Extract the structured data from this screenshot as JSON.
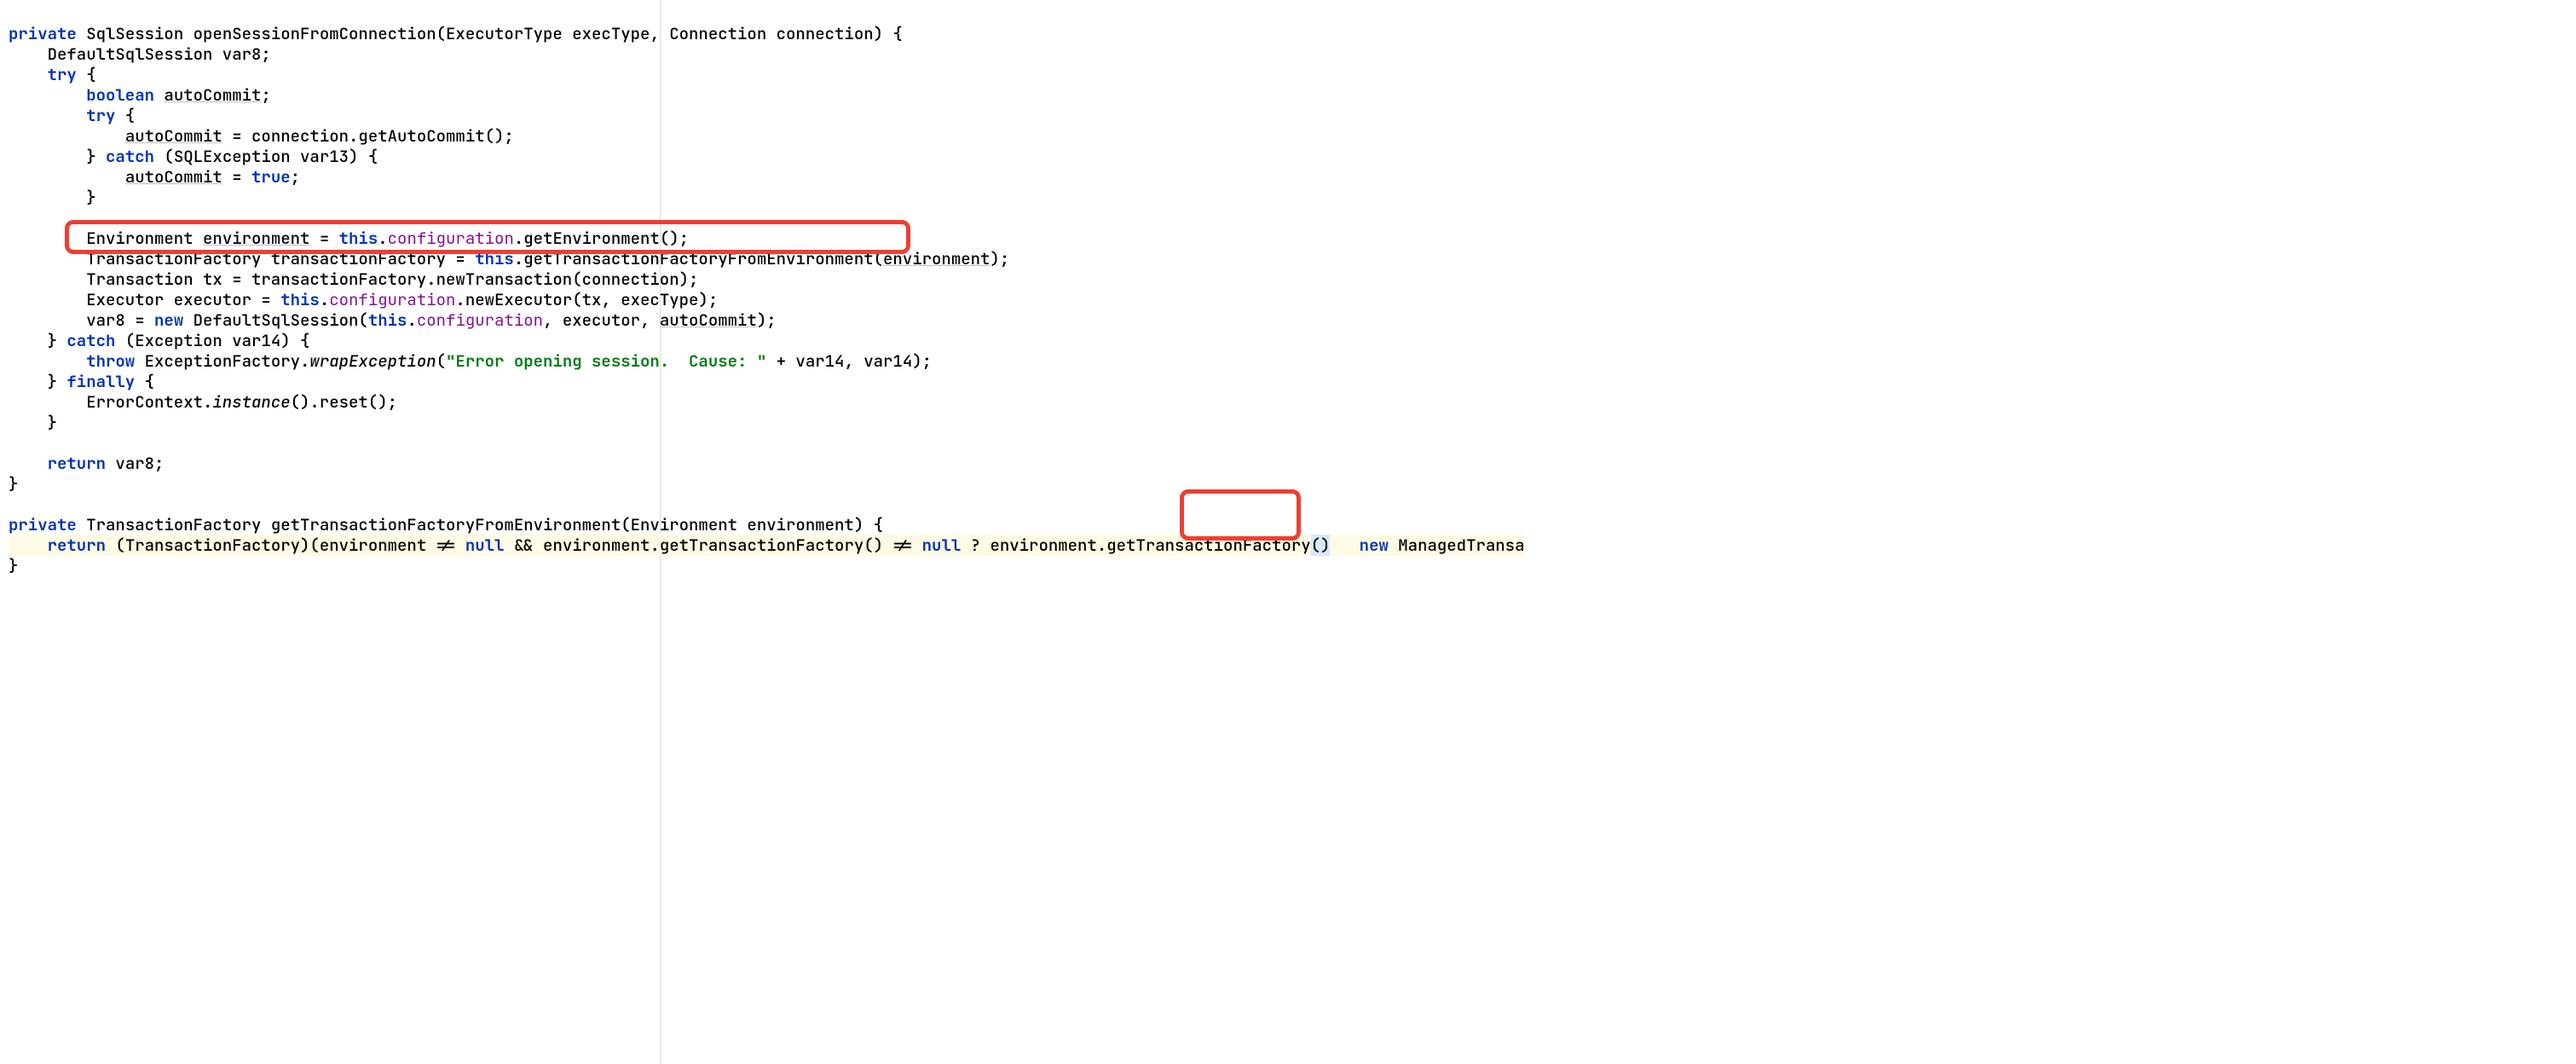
{
  "code": {
    "l01_a": "private",
    "l01_b": " SqlSession openSessionFromConnection(ExecutorType execType, Connection connection) {",
    "l02": "    DefaultSqlSession var8;",
    "l03_a": "    ",
    "l03_b": "try",
    "l03_c": " {",
    "l04_a": "        ",
    "l04_b": "boolean",
    "l04_c": " ",
    "l04_d": "autoCommit",
    "l04_e": ";",
    "l05_a": "        ",
    "l05_b": "try",
    "l05_c": " {",
    "l06_a": "            ",
    "l06_b": "autoCommit",
    "l06_c": " = connection.getAutoCommit();",
    "l07_a": "        } ",
    "l07_b": "catch",
    "l07_c": " (SQLException var13) {",
    "l08_a": "            ",
    "l08_b": "autoCommit",
    "l08_c": " = ",
    "l08_d": "true",
    "l08_e": ";",
    "l09": "        }",
    "l10": "",
    "l11_a": "        Environment ",
    "l11_b": "environment",
    "l11_c": " = ",
    "l11_d": "this",
    "l11_e": ".",
    "l11_f": "configuration",
    "l11_g": ".getEnvironment();",
    "l12_a": "        TransactionFactory transactionFactory = ",
    "l12_b": "this",
    "l12_c": ".getTransactionFactoryFromEnvironment(",
    "l12_d": "environment",
    "l12_e": ");",
    "l13": "        Transaction tx = transactionFactory.newTransaction(connection);",
    "l14_a": "        Executor executor = ",
    "l14_b": "this",
    "l14_c": ".",
    "l14_d": "configuration",
    "l14_e": ".newExecutor(tx, execType);",
    "l15_a": "        var8 = ",
    "l15_b": "new",
    "l15_c": " DefaultSqlSession(",
    "l15_d": "this",
    "l15_e": ".",
    "l15_f": "configuration",
    "l15_g": ", executor, ",
    "l15_h": "autoCommit",
    "l15_i": ");",
    "l16_a": "    } ",
    "l16_b": "catch",
    "l16_c": " (Exception var14) {",
    "l17_a": "        ",
    "l17_b": "throw",
    "l17_c": " ExceptionFactory.",
    "l17_d": "wrapException",
    "l17_e": "(",
    "l17_f": "\"Error opening session.  Cause: \"",
    "l17_g": " + var14, var14);",
    "l18_a": "    } ",
    "l18_b": "finally",
    "l18_c": " {",
    "l19_a": "        ErrorContext.",
    "l19_b": "instance",
    "l19_c": "().reset();",
    "l20": "    }",
    "l21": "",
    "l22_a": "    ",
    "l22_b": "return",
    "l22_c": " var8;",
    "l23": "}",
    "l24": "",
    "l25_a": "private",
    "l25_b": " TransactionFactory getTransactionFactoryFromEnvironment(Environment environment) {",
    "l26_a": "    ",
    "l26_b": "return",
    "l26_c": " (TransactionFactory)(environment != ",
    "l26_d": "null",
    "l26_e": " && environment.getTransactionFactory() != ",
    "l26_f": "null",
    "l26_g": " ? environment.getTransactionFactory",
    "l26_h": "()",
    "l26_i": "   ",
    "l26_j": "new",
    "l26_k": " ManagedTransa",
    "l27": "}"
  }
}
